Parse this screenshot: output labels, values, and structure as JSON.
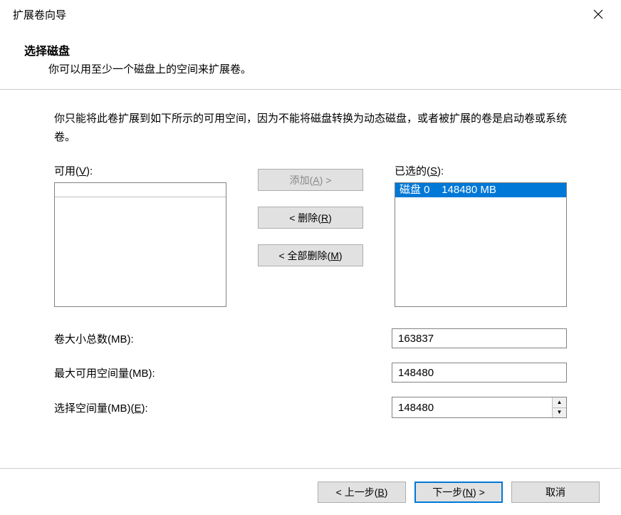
{
  "window": {
    "title": "扩展卷向导"
  },
  "heading": {
    "title": "选择磁盘",
    "subtitle": "你可以用至少一个磁盘上的空间来扩展卷。"
  },
  "info_text": "你只能将此卷扩展到如下所示的可用空间，因为不能将磁盘转换为动态磁盘，或者被扩展的卷是启动卷或系统卷。",
  "available": {
    "label_pre": "可用(",
    "label_mn": "V",
    "label_post": "):",
    "items": []
  },
  "selected": {
    "label_pre": "已选的(",
    "label_mn": "S",
    "label_post": "):",
    "items": [
      {
        "text": "磁盘 0    148480 MB",
        "selected": true
      }
    ]
  },
  "buttons": {
    "add_pre": "添加(",
    "add_mn": "A",
    "add_post": ") >",
    "remove_pre": "< 删除(",
    "remove_mn": "R",
    "remove_post": ")",
    "remove_all_pre": "< 全部删除(",
    "remove_all_mn": "M",
    "remove_all_post": ")"
  },
  "fields": {
    "total_label": "卷大小总数(MB):",
    "total_value": "163837",
    "max_label": "最大可用空间量(MB):",
    "max_value": "148480",
    "select_label_pre": "选择空间量(MB)(",
    "select_label_mn": "E",
    "select_label_post": "):",
    "select_value": "148480"
  },
  "footer": {
    "back_pre": "< 上一步(",
    "back_mn": "B",
    "back_post": ")",
    "next_pre": "下一步(",
    "next_mn": "N",
    "next_post": ") >",
    "cancel": "取消"
  }
}
